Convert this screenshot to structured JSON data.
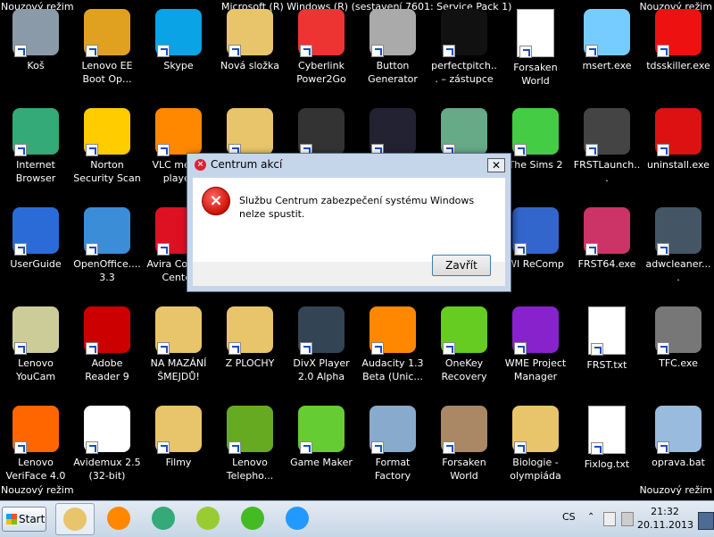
{
  "desktop": {
    "safe_mode_label": "Nouzový režim",
    "build_text": "Microsoft (R) Windows (R) (sestavení 7601: Service Pack 1)",
    "icons": [
      {
        "label": "Koš",
        "icon": "recycle-bin-icon",
        "color": "#8a9aa8"
      },
      {
        "label": "Lenovo EE Boot Op...",
        "icon": "lenovo-boot-optimizer-icon",
        "color": "#e0a020"
      },
      {
        "label": "Skype",
        "icon": "skype-icon",
        "color": "#0aa3e6"
      },
      {
        "label": "Nová složka",
        "icon": "folder-icon",
        "color": "#e8c56a"
      },
      {
        "label": "Cyberlink Power2Go",
        "icon": "power2go-icon",
        "color": "#e33"
      },
      {
        "label": "Button Generator",
        "icon": "button-generator-icon",
        "color": "#aaa"
      },
      {
        "label": "perfectpitch... – zástupce",
        "icon": "shortcut-icon",
        "color": "#111"
      },
      {
        "label": "Forsaken World",
        "icon": "document-icon",
        "color": "#fff"
      },
      {
        "label": "msert.exe",
        "icon": "msert-icon",
        "color": "#7cf"
      },
      {
        "label": "tdsskiller.exe",
        "icon": "kaspersky-icon",
        "color": "#e11"
      },
      {
        "label": "Internet Browser",
        "icon": "chrome-icon",
        "color": "#3a7"
      },
      {
        "label": "Norton Security Scan",
        "icon": "norton-icon",
        "color": "#fc0"
      },
      {
        "label": "VLC media player",
        "icon": "vlc-icon",
        "color": "#f80"
      },
      {
        "label": "",
        "icon": "folder-icon",
        "color": "#e8c56a"
      },
      {
        "label": "",
        "icon": "app-icon",
        "color": "#333"
      },
      {
        "label": "",
        "icon": "app-icon",
        "color": "#223"
      },
      {
        "label": "",
        "icon": "app-icon",
        "color": "#6a8"
      },
      {
        "label": "The Sims 2",
        "icon": "sims-icon",
        "color": "#4c4"
      },
      {
        "label": "FRSTLaunch...",
        "icon": "frst-launcher-icon",
        "color": "#444"
      },
      {
        "label": "uninstall.exe",
        "icon": "uninstall-icon",
        "color": "#d11"
      },
      {
        "label": "UserGuide",
        "icon": "user-guide-icon",
        "color": "#2a6bd8"
      },
      {
        "label": "OpenOffice.... 3.3",
        "icon": "openoffice-icon",
        "color": "#3c8dd8"
      },
      {
        "label": "Avira Control Center",
        "icon": "avira-icon",
        "color": "#d12"
      },
      {
        "label": "",
        "icon": "app-icon",
        "color": "#000"
      },
      {
        "label": "",
        "icon": "app-icon",
        "color": "#000"
      },
      {
        "label": "",
        "icon": "app-icon",
        "color": "#000"
      },
      {
        "label": "",
        "icon": "app-icon",
        "color": "#000"
      },
      {
        "label": "WI ReComp",
        "icon": "recomp-icon",
        "color": "#36c"
      },
      {
        "label": "FRST64.exe",
        "icon": "frst64-icon",
        "color": "#c36"
      },
      {
        "label": "adwcleaner....",
        "icon": "adwcleaner-icon",
        "color": "#456"
      },
      {
        "label": "Lenovo YouCam",
        "icon": "youcam-icon",
        "color": "#cc9"
      },
      {
        "label": "Adobe Reader 9",
        "icon": "adobe-reader-icon",
        "color": "#c00"
      },
      {
        "label": "NA MAZÁNÍ ŠMEJDŮ!",
        "icon": "folder-icon",
        "color": "#e8c56a"
      },
      {
        "label": "Z PLOCHY",
        "icon": "folder-icon",
        "color": "#e8c56a"
      },
      {
        "label": "DivX Player 2.0 Alpha",
        "icon": "divx-icon",
        "color": "#345"
      },
      {
        "label": "Audacity 1.3 Beta (Unic...",
        "icon": "audacity-icon",
        "color": "#f80"
      },
      {
        "label": "OneKey Recovery",
        "icon": "onekey-recovery-icon",
        "color": "#6c2"
      },
      {
        "label": "WME Project Manager",
        "icon": "wme-icon",
        "color": "#82c"
      },
      {
        "label": "FRST.txt",
        "icon": "text-file-icon",
        "color": "#fff"
      },
      {
        "label": "TFC.exe",
        "icon": "tfc-icon",
        "color": "#777"
      },
      {
        "label": "Lenovo VeriFace 4.0",
        "icon": "veriface-icon",
        "color": "#f60"
      },
      {
        "label": "Avidemux 2.5 (32-bit)",
        "icon": "avidemux-icon",
        "color": "#fff"
      },
      {
        "label": "Filmy",
        "icon": "folder-icon",
        "color": "#e8c56a"
      },
      {
        "label": "Lenovo Telepho...",
        "icon": "telephony-icon",
        "color": "#6a2"
      },
      {
        "label": "Game Maker",
        "icon": "game-maker-icon",
        "color": "#6c3"
      },
      {
        "label": "Format Factory",
        "icon": "format-factory-icon",
        "color": "#8ac"
      },
      {
        "label": "Forsaken World",
        "icon": "forsaken-world-icon",
        "color": "#a86"
      },
      {
        "label": "Biologie - olympiáda",
        "icon": "folder-icon",
        "color": "#e8c56a"
      },
      {
        "label": "Fixlog.txt",
        "icon": "text-file-icon",
        "color": "#fff"
      },
      {
        "label": "oprava.bat",
        "icon": "batch-file-icon",
        "color": "#9bd"
      }
    ]
  },
  "dialog": {
    "title": "Centrum akcí",
    "close_glyph": "✕",
    "message": "Službu Centrum zabezpečení systému Windows nelze spustit.",
    "button_label": "Zavřít"
  },
  "taskbar": {
    "start_label": "Start",
    "pinned": [
      {
        "name": "explorer",
        "icon": "explorer-folder-icon",
        "color": "#e8c56a",
        "active": true
      },
      {
        "name": "media-player",
        "icon": "media-player-icon",
        "color": "#f80",
        "active": false
      },
      {
        "name": "chrome",
        "icon": "chrome-icon",
        "color": "#3a7",
        "active": false
      },
      {
        "name": "windows",
        "icon": "windows-icon",
        "color": "#9c3",
        "active": false
      },
      {
        "name": "icq",
        "icon": "icq-icon",
        "color": "#4b2",
        "active": false
      },
      {
        "name": "internet-explorer",
        "icon": "ie-icon",
        "color": "#29f",
        "active": false
      }
    ],
    "language": "CS",
    "time": "21:32",
    "date": "20.11.2013"
  }
}
